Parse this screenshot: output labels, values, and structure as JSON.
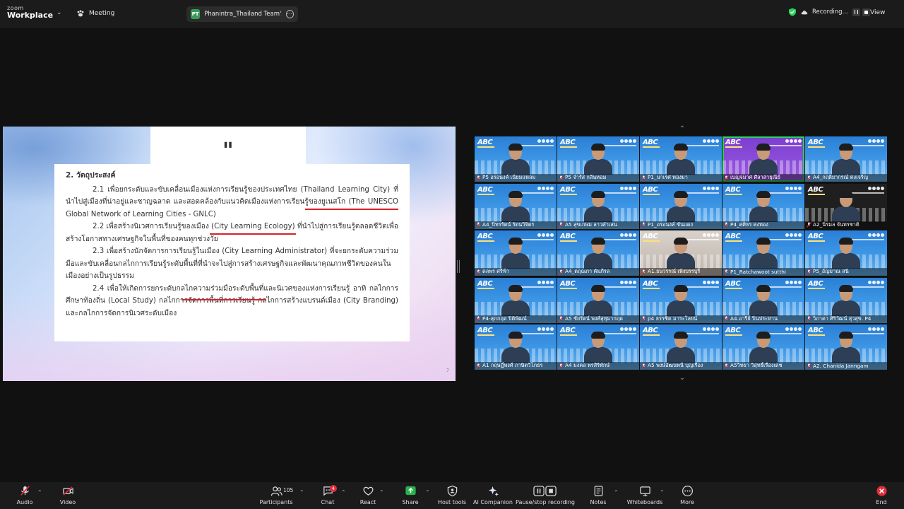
{
  "app": {
    "brand_top": "zoom",
    "brand_bottom": "Workplace",
    "meeting_label": "Meeting",
    "share_badge": "PT",
    "share_label": "Phanintra_Thailand Team's scree",
    "recording_label": "Recording...",
    "view_label": "View"
  },
  "slide": {
    "quote": "\"",
    "heading": "2. วัตถุประสงค์",
    "para1": "2.1 เพื่อยกระดับและขับเคลื่อนเมืองแห่งการเรียนรู้ของประเทศไทย  (Thailand Learning City) ที่นำไปสู่เมืองที่น่าอยู่และชาญฉลาด และสอดคล้องกับแนวคิดเมืองแห่งการเรียนรู้ของยูเนสโก (The UNESCO Global Network of Learning Cities - GNLC)",
    "para2": "2.2 เพื่อสร้างนิเวศการเรียนรู้ของเมือง (City Learning Ecology) ที่นำไปสู่การเรียนรู้ตลอดชีวิตเพื่อสร้างโอกาสทางเศรษฐกิจในพื้นที่ของคนทุกช่วงวัย",
    "para3": "2.3 เพื่อสร้างนักจัดการการเรียนรู้ในเมือง (City Learning Administrator) ที่จะยกระดับความร่วมมือและขับเคลื่อนกลไกการเรียนรู้ระดับพื้นที่ที่นำจะไปสู่การสร้างเศรษฐกิจและพัฒนาคุณภาพชีวิตของคนในเมืองอย่างเป็นรูปธรรม",
    "para4": "2.4 เพื่อให้เกิดการยกระดับกลไกความร่วมมือระดับพื้นที่และนิเวศของแห่งการเรียนรู้ อาทิ กลไกการศึกษาท้องถิ่น (Local Study) กลไกการจัดการพื้นที่การเรียนรู้ กลไกการสร้างแบรนด์เมือง (City Branding) และกลไกการจัดการนิเวศระดับเมือง",
    "page_number": "7"
  },
  "gallery": {
    "logo_text": "ABC",
    "participants": [
      {
        "name": "P5 อรอนงค์ เนียมแหลม"
      },
      {
        "name": "P5 จำรัส กลิ่นหอม"
      },
      {
        "name": "P1_นาเรศ ทองมา"
      },
      {
        "name": "เบญจมาศ ศิลาสาธุณีย์"
      },
      {
        "name": "A4_กฤติยากรณ์ คงเจริญ"
      },
      {
        "name": "A4_ปิ่ทรรัตน์ รัตนวิจิตร"
      },
      {
        "name": "A5 สุขเกษม ลาวคำเสน"
      },
      {
        "name": "P1_อรอนงค์ ขันแดง"
      },
      {
        "name": "P4_ศศิธร คงทอง"
      },
      {
        "name": "A2_นิรมล จันทรชาติ"
      },
      {
        "name": "ดลพร ศรีฟ้า"
      },
      {
        "name": "A4_ตฤณภา คัมภีรล"
      },
      {
        "name": "A1.ธนวรรณ์ เพิ่งบรรบุรี"
      },
      {
        "name": "P1_Ratchawoot sutthi"
      },
      {
        "name": "P5_อัญมาณ สนิ"
      },
      {
        "name": "P4-สุภกฤต ปิติพัฒน์"
      },
      {
        "name": "A5 ชัยรัตน์ พงศ์สุทุมากฤต"
      },
      {
        "name": "p4 ธรรชิต มาระโลยน์"
      },
      {
        "name": "A4.อารีย์ ปิ่นประหาน"
      },
      {
        "name": "วิภาดา ศิริวัฒน์ สุวสุข. P4"
      },
      {
        "name": "A1 กฤษฏิ์พงศ์ ภาษิตวิโภธร"
      },
      {
        "name": "A4 มงคล พรสิริทักษ์"
      },
      {
        "name": "A5 พงษ์อัฒนพนี บุญเรือง"
      },
      {
        "name": "A5วิทยา วิสุทธิ์เรืองเดช"
      },
      {
        "name": "A2. Chanida Janngam"
      }
    ]
  },
  "toolbar": {
    "audio": "Audio",
    "video": "Video",
    "participants": "Participants",
    "participants_count": "105",
    "chat": "Chat",
    "chat_badge": "4",
    "react": "React",
    "share": "Share",
    "host_tools": "Host tools",
    "ai_companion": "AI Companion",
    "pause_stop_recording": "Pause/stop recording",
    "notes": "Notes",
    "whiteboards": "Whiteboards",
    "more": "More",
    "end": "End"
  },
  "colors": {
    "accent_green": "#2bd35a",
    "end_red": "#e02e3c",
    "share_green": "#2bb24c",
    "muted_red": "#e0283a"
  }
}
